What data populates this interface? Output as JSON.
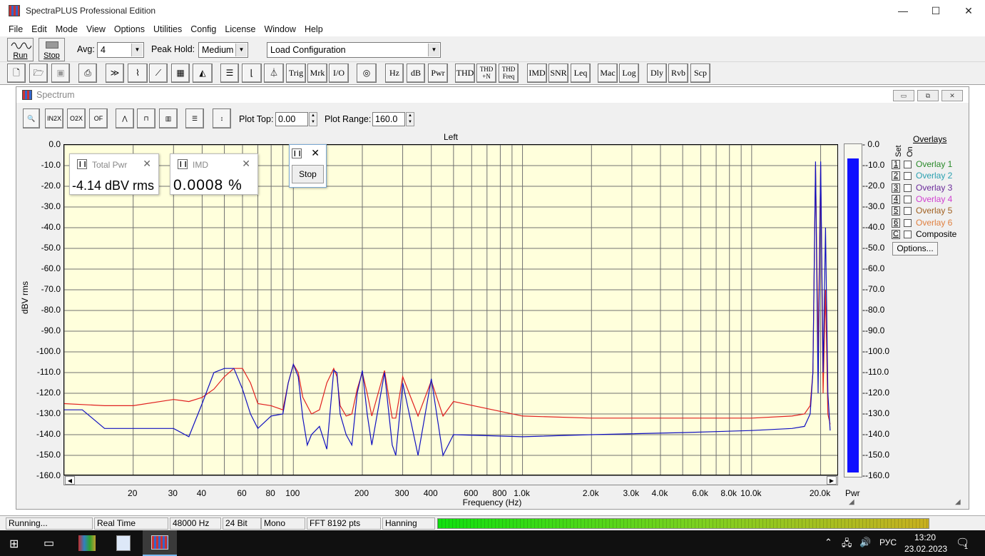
{
  "app": {
    "title": "SpectraPLUS Professional Edition",
    "window_controls": {
      "minimize": "—",
      "maximize": "☐",
      "close": "✕"
    }
  },
  "menu": [
    "File",
    "Edit",
    "Mode",
    "View",
    "Options",
    "Utilities",
    "Config",
    "License",
    "Window",
    "Help"
  ],
  "toolbar1": {
    "run_label": "Run",
    "stop_label": "Stop",
    "avg_label": "Avg:",
    "avg_value": "4",
    "peak_hold_label": "Peak Hold:",
    "peak_hold_value": "Medium",
    "config_value": "Load Configuration"
  },
  "toolbar2": {
    "text_buttons": [
      "Trig",
      "Mrk",
      "I/O",
      "Hz",
      "dB",
      "Pwr",
      "THD",
      "THD +N",
      "THD Freq",
      "IMD",
      "SNR",
      "Leq",
      "Mac",
      "Log",
      "Dly",
      "Rvb",
      "Scp"
    ],
    "icon_buttons": [
      "new-icon",
      "open-icon",
      "save-icon",
      "print-icon",
      "forward-icon",
      "scope-icon",
      "ramp-icon",
      "spectrogram-icon",
      "3d-icon",
      "view-icon",
      "bracket-icon",
      "tone-icon",
      "sine-icon"
    ]
  },
  "spectrum_window": {
    "title": "Spectrum",
    "mdi_buttons": [
      "▭",
      "⧉",
      "✕"
    ],
    "tools": [
      "zoom-icon",
      "zoom-in-2x-icon",
      "zoom-out-2x-icon",
      "zoom-out-full-icon",
      "line-icon",
      "step-icon",
      "bars-icon",
      "list-icon",
      "scale-icon"
    ],
    "plot_top_label": "Plot Top:",
    "plot_top_value": "0.00",
    "plot_range_label": "Plot Range:",
    "plot_range_value": "160.0"
  },
  "meters": {
    "total_pwr": {
      "title": "Total Pwr",
      "value": "-4.14 dBV rms"
    },
    "imd": {
      "title": "IMD",
      "value": "0.0008 %"
    },
    "stop_popup": {
      "button": "Stop"
    }
  },
  "overlays": {
    "title": "Overlays",
    "set_label": "Set",
    "on_label": "On",
    "items": [
      {
        "num": "1",
        "name": "Overlay 1",
        "color": "#2a8a2a"
      },
      {
        "num": "2",
        "name": "Overlay 2",
        "color": "#2aa0b0"
      },
      {
        "num": "3",
        "name": "Overlay 3",
        "color": "#6a2a9a"
      },
      {
        "num": "4",
        "name": "Overlay 4",
        "color": "#d040d0"
      },
      {
        "num": "5",
        "name": "Overlay 5",
        "color": "#a06020"
      },
      {
        "num": "6",
        "name": "Overlay 6",
        "color": "#e08040"
      },
      {
        "num": "C",
        "name": "Composite",
        "color": "#000000"
      }
    ],
    "options_button": "Options..."
  },
  "chart_data": {
    "type": "line",
    "title": "Left",
    "xlabel": "Frequency (Hz)",
    "ylabel": "dBV rms",
    "x_scale": "log",
    "xlim": [
      10,
      24000
    ],
    "ylim": [
      -160,
      0
    ],
    "grid": true,
    "y_ticks": [
      "0.0",
      "-10.0",
      "-20.0",
      "-30.0",
      "-40.0",
      "-50.0",
      "-60.0",
      "-70.0",
      "-80.0",
      "-90.0",
      "-100.0",
      "-110.0",
      "-120.0",
      "-130.0",
      "-140.0",
      "-150.0",
      "-160.0"
    ],
    "x_ticks": [
      "20",
      "30",
      "40",
      "60",
      "80",
      "100",
      "200",
      "300",
      "400",
      "600",
      "800",
      "1.0k",
      "2.0k",
      "3.0k",
      "4.0k",
      "6.0k",
      "8.0k",
      "10.0k",
      "20.0k"
    ],
    "x_tick_values": [
      20,
      30,
      40,
      60,
      80,
      100,
      200,
      300,
      400,
      600,
      800,
      1000,
      2000,
      3000,
      4000,
      6000,
      8000,
      10000,
      20000
    ],
    "series": [
      {
        "color": "#e02020",
        "x": [
          10,
          15,
          20,
          30,
          35,
          40,
          45,
          50,
          55,
          60,
          65,
          70,
          80,
          90,
          95,
          100,
          105,
          110,
          120,
          130,
          140,
          150,
          155,
          160,
          170,
          180,
          190,
          200,
          210,
          220,
          250,
          270,
          280,
          300,
          350,
          400,
          450,
          500,
          1000,
          2000,
          5000,
          10000,
          15000,
          17000,
          18000,
          18500,
          19000,
          19500,
          20000,
          20500,
          21000,
          21500,
          22000
        ],
        "y": [
          -125,
          -126,
          -126,
          -123,
          -124,
          -122,
          -118,
          -112,
          -108,
          -108,
          -115,
          -125,
          -126,
          -128,
          -115,
          -106,
          -110,
          -122,
          -130,
          -128,
          -115,
          -108,
          -112,
          -126,
          -131,
          -130,
          -118,
          -110,
          -120,
          -131,
          -109,
          -132,
          -132,
          -112,
          -131,
          -114,
          -131,
          -124,
          -131,
          -132,
          -132,
          -132,
          -131,
          -130,
          -126,
          -110,
          -10,
          -100,
          -10,
          -120,
          -70,
          -130,
          -135
        ]
      },
      {
        "color": "#1010c0",
        "x": [
          10,
          12,
          15,
          20,
          25,
          30,
          35,
          40,
          45,
          50,
          55,
          60,
          65,
          70,
          80,
          90,
          95,
          100,
          105,
          110,
          115,
          120,
          130,
          140,
          150,
          155,
          160,
          170,
          180,
          190,
          200,
          210,
          220,
          250,
          270,
          280,
          300,
          350,
          400,
          450,
          500,
          1000,
          2000,
          5000,
          10000,
          15000,
          17000,
          18000,
          18500,
          19000,
          19500,
          20000,
          20500,
          21000,
          21500,
          22000
        ],
        "y": [
          -128,
          -128,
          -137,
          -137,
          -137,
          -137,
          -141,
          -125,
          -110,
          -108,
          -108,
          -118,
          -130,
          -137,
          -131,
          -130,
          -115,
          -106,
          -112,
          -132,
          -145,
          -140,
          -136,
          -147,
          -109,
          -110,
          -130,
          -140,
          -145,
          -120,
          -109,
          -130,
          -145,
          -110,
          -145,
          -150,
          -115,
          -150,
          -113,
          -150,
          -140,
          -141,
          -140,
          -139,
          -138,
          -137,
          -136,
          -130,
          -110,
          -8,
          -120,
          -8,
          -110,
          -40,
          -120,
          -138
        ]
      }
    ],
    "bar_meter": {
      "label": "Pwr",
      "level_fraction": 0.97,
      "color": "#1010ff"
    }
  },
  "status": {
    "state": "Running...",
    "mode": "Real Time",
    "rate": "48000 Hz",
    "bits": "24 Bit",
    "channels": "Mono",
    "fft": "FFT 8192 pts",
    "window": "Hanning"
  },
  "taskbar": {
    "language": "РУС",
    "time": "13:20",
    "date": "23.02.2023",
    "notification_count": "1"
  }
}
